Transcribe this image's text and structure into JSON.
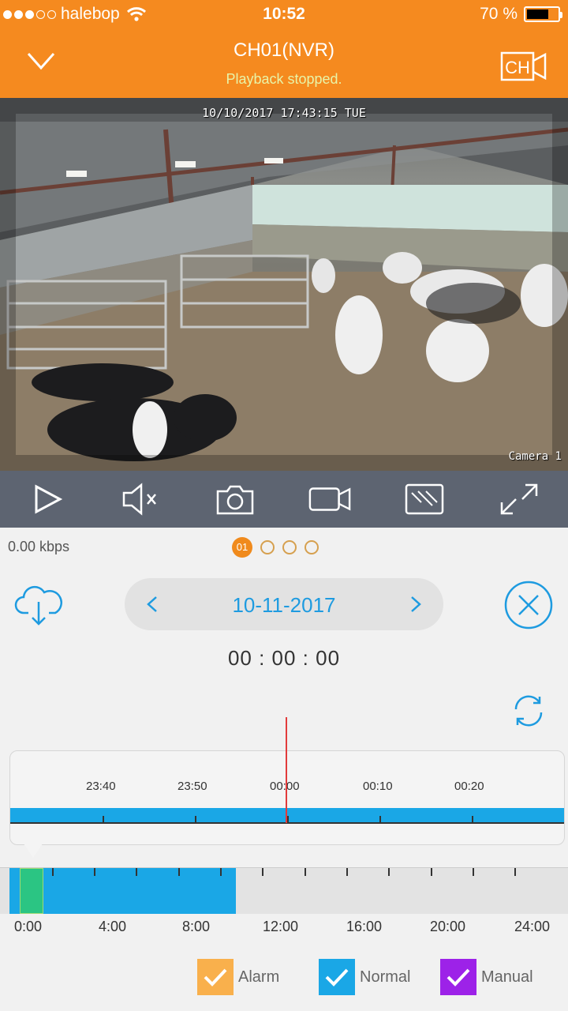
{
  "status": {
    "carrier": "halebop",
    "time": "10:52",
    "battery": "70 %",
    "battery_level": 0.7
  },
  "header": {
    "title": "CH01(NVR)",
    "subtitle": "Playback stopped.",
    "ch_label": "CH"
  },
  "video": {
    "osd_time": "10/10/2017 17:43:15 TUE",
    "osd_camera": "Camera 1"
  },
  "stats": {
    "bitrate": "0.00 kbps"
  },
  "pager": {
    "active": "01",
    "count": 4
  },
  "date_nav": {
    "date": "10-11-2017"
  },
  "timecode": "00 : 00 : 00",
  "timeline": {
    "labels": [
      "23:40",
      "23:50",
      "00:00",
      "00:10",
      "00:20"
    ]
  },
  "dayline": {
    "hours": [
      "0:00",
      "4:00",
      "8:00",
      "12:00",
      "16:00",
      "20:00",
      "24:00"
    ],
    "recorded_until_hour": 9.7
  },
  "legend": {
    "alarm": {
      "label": "Alarm",
      "color": "#f9b04c"
    },
    "normal": {
      "label": "Normal",
      "color": "#1aa7e6"
    },
    "manual": {
      "label": "Manual",
      "color": "#9d22e8"
    }
  }
}
